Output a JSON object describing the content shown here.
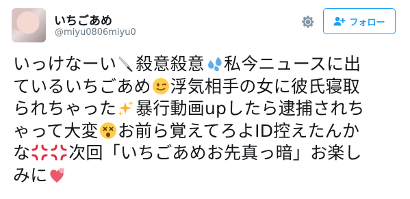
{
  "user": {
    "name": "いちごあめ",
    "handle": "@miyu0806miyu0"
  },
  "actions": {
    "follow_label": "フォロー"
  },
  "icons": {
    "settings": "gear-icon",
    "follow": "add-user-icon"
  },
  "colors": {
    "accent": "#1da1f2",
    "secondary_text": "#657786",
    "icon_gray": "#8899a6"
  },
  "tweet": {
    "lines": [
      {
        "a": "いっけなーい",
        "b": "殺意殺意",
        "c": "私今ニュースに出"
      },
      {
        "a": "ているいちごあめ",
        "b": "浮気相手の女に彼氏寝取"
      },
      {
        "a": "られちゃった",
        "b": "暴行動画upしたら逮捕されち"
      },
      {
        "a": "ゃって大変",
        "b": "お前ら覚えてろよID控えたんか"
      },
      {
        "a": "な",
        "b": "次回「いちごあめお先真っ暗」お楽し"
      },
      {
        "a": "みに"
      }
    ],
    "emoji": [
      "knife-emoji",
      "sweat-droplets-emoji",
      "winking-face-emoji",
      "sparkles-emoji",
      "dizzy-face-emoji",
      "anger-symbol-emoji",
      "anger-symbol-emoji",
      "two-hearts-emoji"
    ]
  }
}
